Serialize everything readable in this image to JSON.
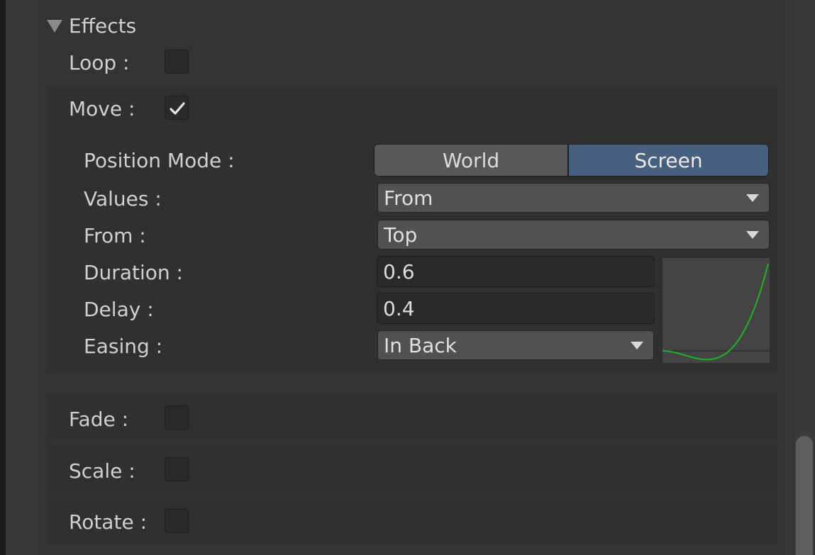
{
  "effects": {
    "title": "Effects",
    "loop": {
      "label": "Loop :",
      "checked": false
    },
    "move": {
      "label": "Move :",
      "checked": true,
      "position_mode": {
        "label": "Position Mode :",
        "options": [
          "World",
          "Screen"
        ],
        "selected": "Screen"
      },
      "values": {
        "label": "Values :",
        "value": "From"
      },
      "from": {
        "label": "From :",
        "value": "Top"
      },
      "duration": {
        "label": "Duration :",
        "value": "0.6"
      },
      "delay": {
        "label": "Delay :",
        "value": "0.4"
      },
      "easing": {
        "label": "Easing :",
        "value": "In Back"
      },
      "curve_color": "#22b322"
    },
    "fade": {
      "label": "Fade :",
      "checked": false
    },
    "scale": {
      "label": "Scale :",
      "checked": false
    },
    "rotate": {
      "label": "Rotate :",
      "checked": false
    }
  },
  "colors": {
    "accent": "#46607e"
  }
}
